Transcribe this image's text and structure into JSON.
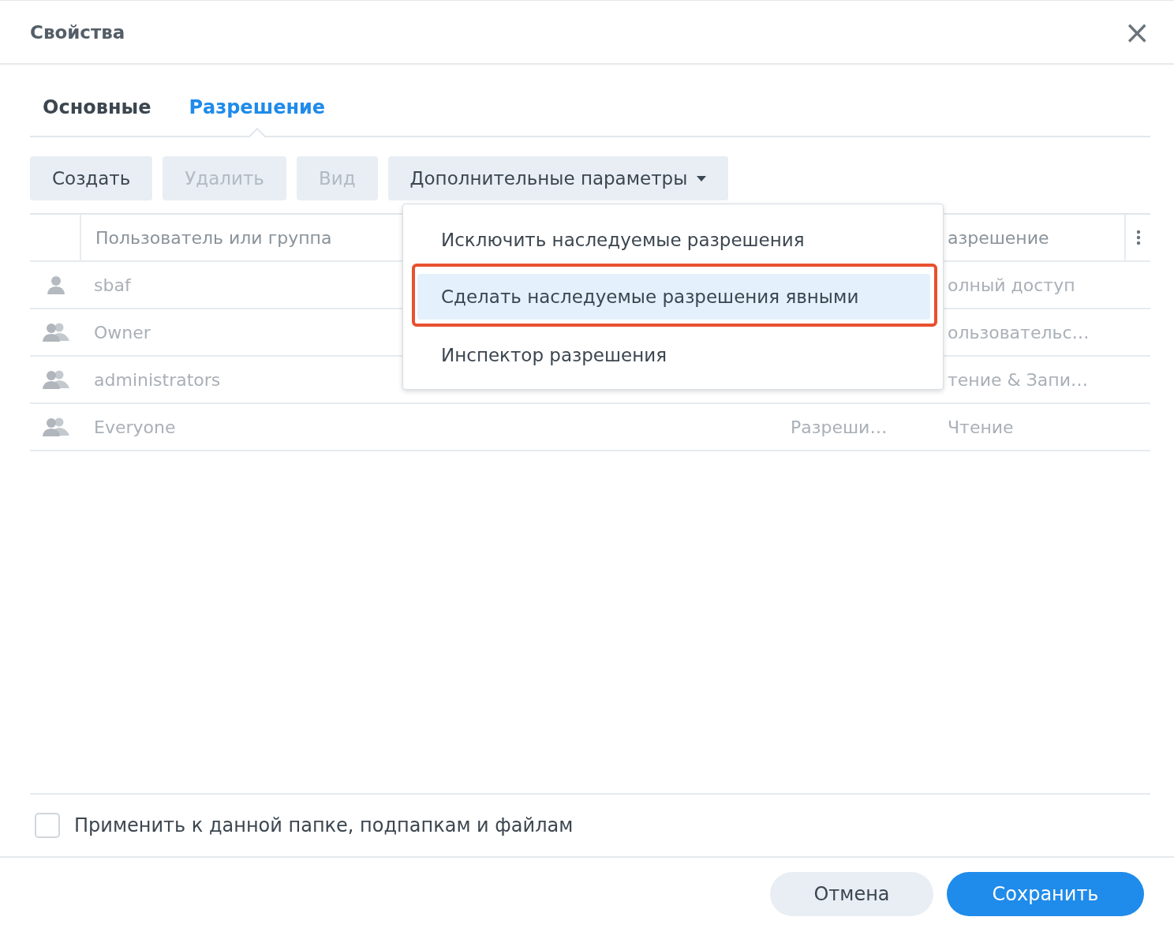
{
  "window": {
    "title": "Свойства",
    "close": "×"
  },
  "tabs": [
    {
      "label": "Основные",
      "selected": false
    },
    {
      "label": "Разрешение",
      "selected": true
    }
  ],
  "toolbar": [
    {
      "label": "Создать",
      "disabled": false,
      "dropdown": false
    },
    {
      "label": "Удалить",
      "disabled": true,
      "dropdown": false
    },
    {
      "label": "Вид",
      "disabled": true,
      "dropdown": false
    },
    {
      "label": "Дополнительные параметры",
      "disabled": false,
      "dropdown": true
    }
  ],
  "table": {
    "columns": [
      {
        "label": "Пользователь или группа"
      },
      {
        "label": "азрешение"
      }
    ],
    "rows": [
      {
        "kind": "user",
        "name": "sbaf",
        "permission": "олный доступ"
      },
      {
        "kind": "group",
        "name": "Owner",
        "permission": "ользовательс…"
      },
      {
        "kind": "group",
        "name": "administrators",
        "permission": "тение & Запи…"
      },
      {
        "kind": "group",
        "name": "Everyone",
        "column_2": "Разреши…",
        "permission": "Чтение"
      }
    ]
  },
  "menu": {
    "items": [
      {
        "label": "Исключить наследуемые разрешения",
        "selected": false,
        "outlined": false
      },
      {
        "label": "Сделать наследуемые разрешения явными",
        "selected": true,
        "outlined": true
      },
      {
        "label": "Инспектор разрешения",
        "selected": false,
        "outlined": false
      }
    ]
  },
  "apply_checkbox": {
    "label": "Применить к данной папке, подпапкам и файлам",
    "checked": false
  },
  "footer": {
    "buttons": [
      {
        "label": "Отмена",
        "kind": "secondary"
      },
      {
        "label": "Сохранить",
        "kind": "primary"
      }
    ]
  }
}
